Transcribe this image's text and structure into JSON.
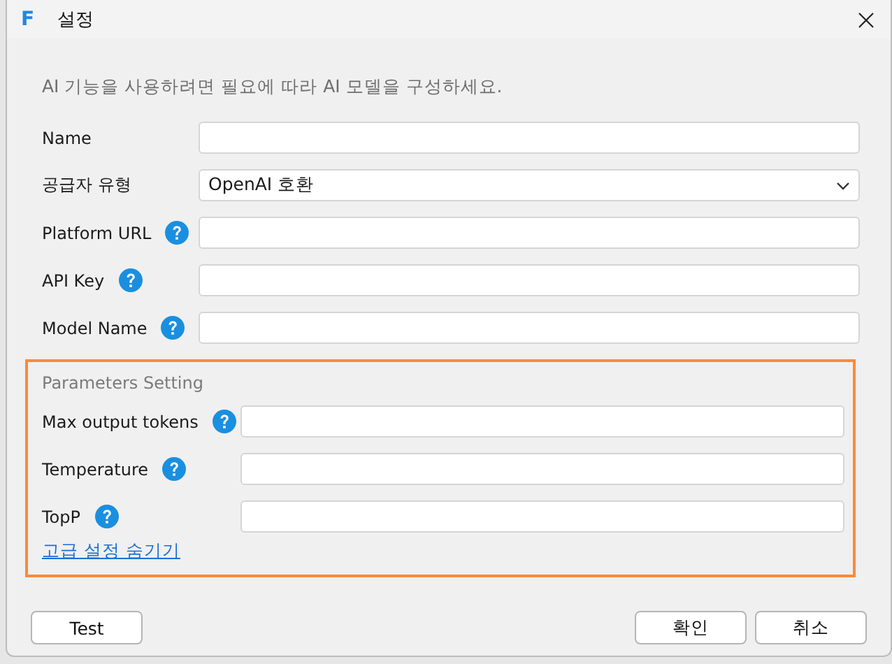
{
  "window": {
    "logo": "F",
    "title": "설정"
  },
  "description": "AI 기능을 사용하려면 필요에 따라 AI 모델을 구성하세요.",
  "fields": [
    {
      "label": "Name",
      "kind": "text",
      "help": false
    },
    {
      "label": "공급자 유형",
      "kind": "select",
      "help": false,
      "value": "OpenAI 호환"
    },
    {
      "label": "Platform URL",
      "kind": "text",
      "help": true
    },
    {
      "label": "API Key",
      "kind": "text",
      "help": true
    },
    {
      "label": "Model Name",
      "kind": "text",
      "help": true
    }
  ],
  "parameters": {
    "title": "Parameters Setting",
    "fields": [
      {
        "label": "Max output tokens",
        "kind": "text",
        "help": true
      },
      {
        "label": "Temperature",
        "kind": "text",
        "help": true
      },
      {
        "label": "TopP",
        "kind": "text",
        "help": true
      }
    ],
    "toggle_link": "고급 설정 숨기기"
  },
  "buttons": {
    "test": "Test",
    "ok": "확인",
    "cancel": "취소"
  }
}
